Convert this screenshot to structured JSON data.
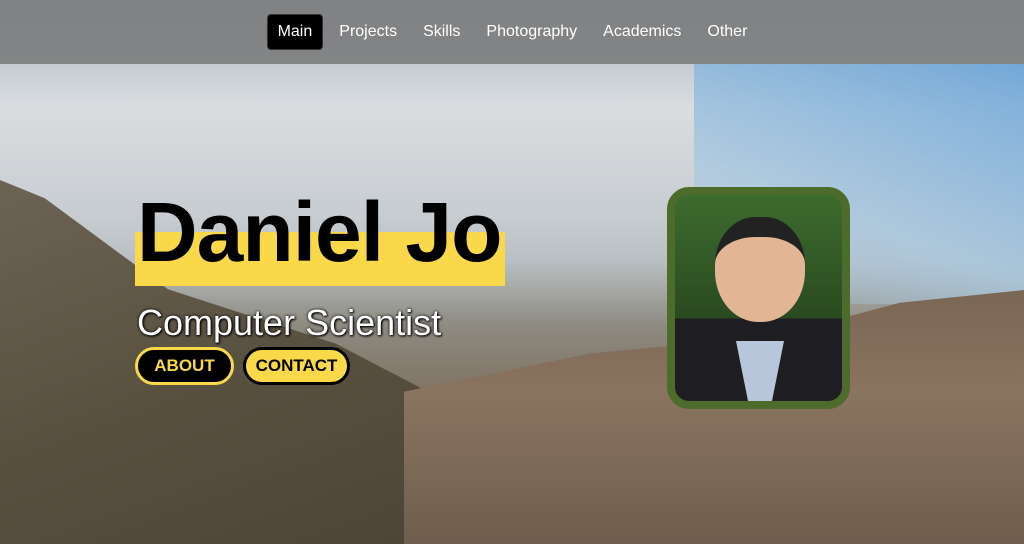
{
  "nav": {
    "items": [
      {
        "label": "Main",
        "active": true
      },
      {
        "label": "Projects"
      },
      {
        "label": "Skills"
      },
      {
        "label": "Photography"
      },
      {
        "label": "Academics"
      },
      {
        "label": "Other"
      }
    ]
  },
  "hero": {
    "name": "Daniel Jo",
    "title": "Computer Scientist",
    "about_label": "ABOUT",
    "contact_label": "CONTACT",
    "accent_color": "#f9d84a"
  }
}
